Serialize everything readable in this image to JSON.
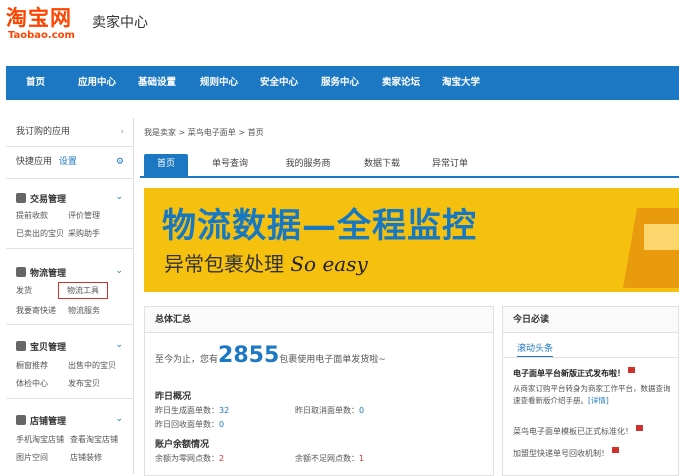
{
  "header": {
    "logo_cn": "淘宝网",
    "logo_en": "Taobao.com",
    "title": "卖家中心"
  },
  "nav": [
    "首页",
    "应用中心",
    "基础设置",
    "规则中心",
    "安全中心",
    "服务中心",
    "卖家论坛",
    "淘宝大学"
  ],
  "sidebar": {
    "my_apps": "我订购的应用",
    "quick_apps": "快捷应用",
    "settings_link": "设置",
    "sections": [
      {
        "title": "交易管理",
        "links": [
          "提前收款",
          "评价管理",
          "已卖出的宝贝",
          "采购助手"
        ]
      },
      {
        "title": "物流管理",
        "links": [
          "发货",
          "物流工具",
          "我要寄快递",
          "物流服务"
        ]
      },
      {
        "title": "宝贝管理",
        "links": [
          "橱窗推荐",
          "出售中的宝贝",
          "体检中心",
          "发布宝贝"
        ]
      },
      {
        "title": "店铺管理",
        "links": [
          "手机淘宝店铺",
          "查看淘宝店铺",
          "图片空间",
          "店铺装修"
        ]
      }
    ]
  },
  "breadcrumb": "我是卖家 > 菜鸟电子面单 > 首页",
  "tabs": [
    "首页",
    "单号查询",
    "我的服务商",
    "数据下载",
    "异常订单"
  ],
  "active_tab": "首页",
  "banner": {
    "line1": "物流数据—全程监控",
    "line2": "异常包裹处理",
    "line2_em": "So easy"
  },
  "summary": {
    "title": "总体汇总",
    "intro_pre": "至今为止，您有",
    "count": "2855",
    "intro_post": "包裹使用电子面单发货啦~",
    "yesterday_title": "昨日概况",
    "yesterday_generated": "昨日生成面单数：",
    "yesterday_generated_val": "32",
    "yesterday_cancel": "昨日取消面单数：",
    "yesterday_cancel_val": "0",
    "yesterday_recycle": "昨日回收面单数：",
    "yesterday_recycle_val": "0",
    "balance_title": "账户余额情况",
    "balance_zero": "余额为零网点数：",
    "balance_zero_val": "2",
    "balance_low": "余额不足网点数：",
    "balance_low_val": "1"
  },
  "must_read": {
    "title": "今日必读",
    "tab": "滚动头条",
    "headline": "电子面单平台新版正式发布啦！",
    "desc": "从商家订购平台转身为商家工作平台，数据查询",
    "desc2": "速查看新版介绍手册。",
    "detail_link": "[详情]",
    "item1": "菜鸟电子面单模板已正式标准化！",
    "item2": "加盟型快递单号回收机制！"
  }
}
